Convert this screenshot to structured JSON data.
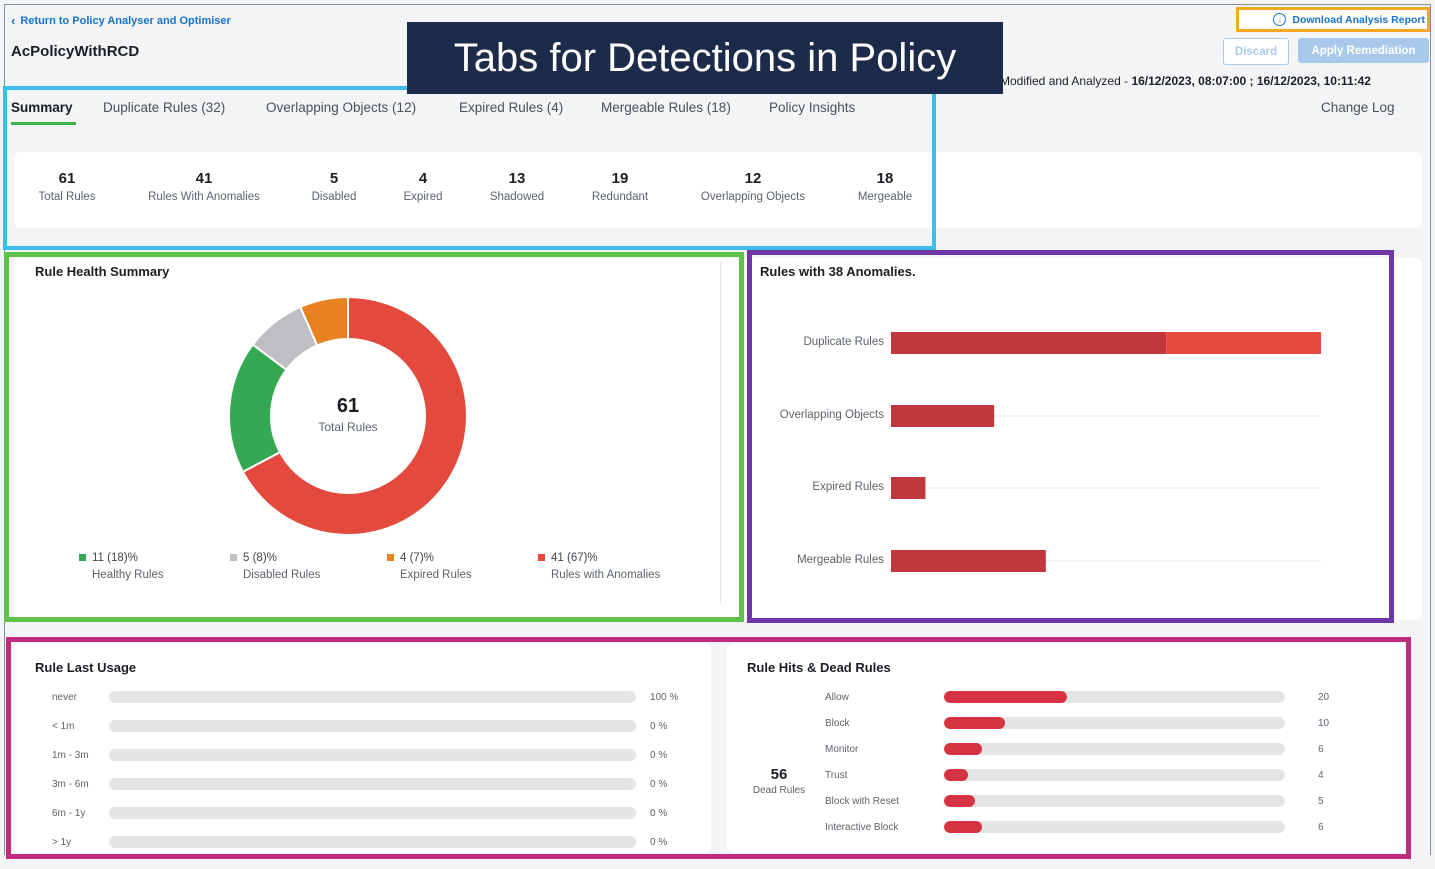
{
  "header": {
    "back_link": "Return to Policy Analyser and Optimiser",
    "policy_name": "AcPolicyWithRCD",
    "download_report": "Download Analysis Report",
    "discard": "Discard",
    "apply_remediation": "Apply Remediation",
    "modified_label": "Modified and Analyzed -",
    "modified_value": "16/12/2023, 08:07:00 ; 16/12/2023, 10:11:42"
  },
  "callout": "Tabs for Detections in Policy",
  "tabs": [
    {
      "label": "Summary",
      "active": true
    },
    {
      "label": "Duplicate Rules (32)"
    },
    {
      "label": "Overlapping Objects (12)"
    },
    {
      "label": "Expired Rules (4)"
    },
    {
      "label": "Mergeable Rules (18)"
    },
    {
      "label": "Policy Insights"
    }
  ],
  "change_log": "Change Log",
  "stats": [
    {
      "value": "61",
      "label": "Total Rules"
    },
    {
      "value": "41",
      "label": "Rules With Anomalies"
    },
    {
      "value": "5",
      "label": "Disabled"
    },
    {
      "value": "4",
      "label": "Expired"
    },
    {
      "value": "13",
      "label": "Shadowed"
    },
    {
      "value": "19",
      "label": "Redundant"
    },
    {
      "value": "12",
      "label": "Overlapping Objects"
    },
    {
      "value": "18",
      "label": "Mergeable"
    }
  ],
  "rule_health": {
    "title": "Rule Health Summary",
    "center_value": "61",
    "center_label": "Total Rules",
    "legend": [
      {
        "value": "11 (18)%",
        "label": "Healthy Rules",
        "color": "#34a853"
      },
      {
        "value": "5 (8)%",
        "label": "Disabled Rules",
        "color": "#bdbfc2"
      },
      {
        "value": "4 (7)%",
        "label": "Expired Rules",
        "color": "#e8811f"
      },
      {
        "value": "41 (67)%",
        "label": "Rules with Anomalies",
        "color": "#e3493c"
      }
    ]
  },
  "anomalies": {
    "title": "Rules with 38 Anomalies.",
    "bars": [
      {
        "label": "Duplicate Rules"
      },
      {
        "label": "Overlapping Objects"
      },
      {
        "label": "Expired Rules"
      },
      {
        "label": "Mergeable Rules"
      }
    ]
  },
  "last_usage": {
    "title": "Rule Last Usage",
    "rows": [
      {
        "label": "never",
        "pct": "100 %"
      },
      {
        "label": "< 1m",
        "pct": "0 %"
      },
      {
        "label": "1m - 3m",
        "pct": "0 %"
      },
      {
        "label": "3m - 6m",
        "pct": "0 %"
      },
      {
        "label": "6m - 1y",
        "pct": "0 %"
      },
      {
        "label": "> 1y",
        "pct": "0 %"
      }
    ]
  },
  "hits": {
    "title": "Rule Hits & Dead Rules",
    "dead_value": "56",
    "dead_label": "Dead Rules",
    "rows": [
      {
        "label": "Allow",
        "value": "20",
        "fraction": 0.36
      },
      {
        "label": "Block",
        "value": "10",
        "fraction": 0.18
      },
      {
        "label": "Monitor",
        "value": "6",
        "fraction": 0.11
      },
      {
        "label": "Trust",
        "value": "4",
        "fraction": 0.07
      },
      {
        "label": "Block with Reset",
        "value": "5",
        "fraction": 0.09
      },
      {
        "label": "Interactive Block",
        "value": "6",
        "fraction": 0.11
      }
    ]
  },
  "chart_data": [
    {
      "type": "pie",
      "title": "Rule Health Summary",
      "categories": [
        "Healthy Rules",
        "Disabled Rules",
        "Expired Rules",
        "Rules with Anomalies"
      ],
      "values": [
        11,
        5,
        4,
        41
      ],
      "colors": [
        "#34a853",
        "#bdbfc2",
        "#e8811f",
        "#e3493c"
      ]
    },
    {
      "type": "bar",
      "title": "Rules with 38 Anomalies.",
      "categories": [
        "Duplicate Rules",
        "Overlapping Objects",
        "Expired Rules",
        "Mergeable Rules"
      ],
      "series": [
        {
          "values": [
            32,
            12,
            4,
            18
          ],
          "color": "#c0373c"
        },
        {
          "values": [
            18,
            0,
            0,
            0
          ],
          "color": "#e3493c"
        }
      ],
      "xlim": [
        0,
        50
      ]
    }
  ]
}
